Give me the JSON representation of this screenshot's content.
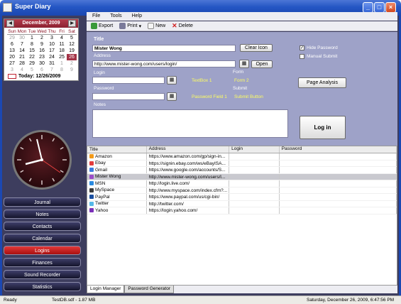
{
  "window": {
    "title": "Super Diary"
  },
  "calendar": {
    "month_label": "December, 2009",
    "weekdays": [
      "Sun",
      "Mon",
      "Tue",
      "Wed",
      "Thu",
      "Fri",
      "Sat"
    ],
    "days": [
      [
        "29",
        "30",
        "1",
        "2",
        "3",
        "4",
        "5"
      ],
      [
        "6",
        "7",
        "8",
        "9",
        "10",
        "11",
        "12"
      ],
      [
        "13",
        "14",
        "15",
        "16",
        "17",
        "18",
        "19"
      ],
      [
        "20",
        "21",
        "22",
        "23",
        "24",
        "25",
        "26"
      ],
      [
        "27",
        "28",
        "29",
        "30",
        "31",
        "1",
        "2"
      ],
      [
        "3",
        "4",
        "5",
        "6",
        "7",
        "8",
        "9"
      ]
    ],
    "selected_day": "26",
    "today_label": "Today: 12/26/2009"
  },
  "nav": {
    "items": [
      "Journal",
      "Notes",
      "Contacts",
      "Calendar",
      "Logins",
      "Finances",
      "Sound Recorder",
      "Statistics"
    ],
    "active": "Logins"
  },
  "menu": {
    "items": [
      "File",
      "Tools",
      "Help"
    ]
  },
  "toolbar": {
    "export": "Export",
    "print": "Print",
    "new": "New",
    "delete": "Delete"
  },
  "form": {
    "title_label": "Title",
    "title_value": "Mister Wong",
    "clear_icon": "Clear Icon",
    "address_label": "Address",
    "address_value": "http://www.mister-wong.com/users/login/",
    "open": "Open",
    "login_label": "Login",
    "password_label": "Password",
    "notes_label": "Notes",
    "form_label": "Form",
    "submit_label": "Submit",
    "textbox_value": "TextBox 1",
    "form_value": "Form 2",
    "password_field_value": "Password Field 1",
    "submit_value": "Submit Button",
    "hide_password": "Hide Password",
    "manual_submit": "Manual Submit",
    "page_analysis": "Page Analysis",
    "log_in": "Log in"
  },
  "grid": {
    "columns": [
      "Title",
      "Address",
      "Login",
      "Password"
    ],
    "rows": [
      {
        "title": "Amazon",
        "address": "https://www.amazon.com/gp/sign-in..."
      },
      {
        "title": "Ebay",
        "address": "https://signin.ebay.com/ws/eBayISA..."
      },
      {
        "title": "Gmail",
        "address": "https://www.google.com/accounts/S..."
      },
      {
        "title": "Mister Wong",
        "address": "http://www.mister-wong.com/users/l..."
      },
      {
        "title": "MSN",
        "address": "http://login.live.com/"
      },
      {
        "title": "MySpace",
        "address": "http://www.myspace.com/index.cfm?..."
      },
      {
        "title": "PayPal",
        "address": "https://www.paypal.com/us/cgi-bin/"
      },
      {
        "title": "Twitter",
        "address": "http://twitter.com/"
      },
      {
        "title": "Yahoo",
        "address": "https://login.yahoo.com/"
      }
    ],
    "selected": "Mister Wong"
  },
  "tabs": [
    "Login Manager",
    "Password Generator"
  ],
  "status": {
    "ready": "Ready",
    "file": "TestDB.sdf - 1.87 MB",
    "datetime": "Saturday, December 26, 2009, 6:47:56 PM"
  },
  "colors": {
    "accent": "#a33246",
    "nav_active": "#d42222",
    "form_bg": "#9ea2c8",
    "window_bg": "#3d3d5e"
  }
}
